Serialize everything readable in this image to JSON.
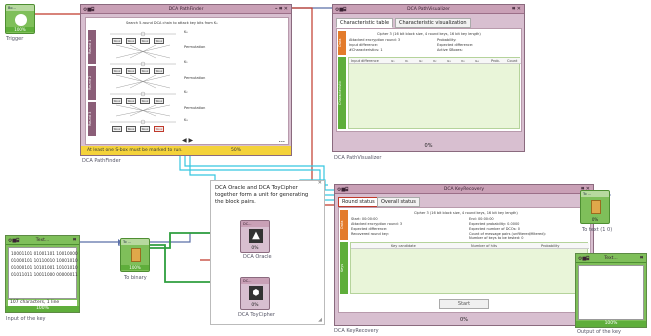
{
  "trigger": {
    "title": "Bo...",
    "percent": "100%",
    "label": "Trigger"
  },
  "pathfinder": {
    "title": "DCA PathFinder",
    "header_text": "Search 5-round DCA chain to attack key bits from K₀",
    "round_labels": [
      "Round 1",
      "Round 2",
      "Round 3"
    ],
    "side_labels": [
      "K₀",
      "K₁",
      "K₂",
      "K₃"
    ],
    "sbox_label": "Sbox",
    "perm_label": "Permutation",
    "warning": "At least one S-box must be marked to run.",
    "percent": "50%",
    "label": "DCA PathFinder",
    "dots": "•••"
  },
  "pathvisualizer": {
    "title": "DCA PathVisualizer",
    "tabs": [
      "Characteristic table",
      "Characteristic visualization"
    ],
    "caption": "Cipher 3 (16 bit block size, 4 round keys, 16 bit key length)",
    "info_left": [
      "Attacked encryption round: 3",
      "Input difference:",
      "#Characteristics: 1"
    ],
    "info_right": [
      "Probability:",
      "Expected difference:",
      "Active SBoxes:"
    ],
    "side_labels": [
      "Data",
      "Characteristic"
    ],
    "columns": [
      "Input difference",
      "u₁",
      "v₁",
      "u₂",
      "v₂",
      "u₃",
      "v₃",
      "u₄",
      "Prob.",
      "Count"
    ],
    "percent": "0%",
    "label": "DCA PathVisualizer"
  },
  "keyrecovery": {
    "title": "DCA KeyRecovery",
    "tabs": [
      "Round status",
      "Overall status"
    ],
    "caption": "Cipher 3 (16 bit block size, 4 round keys, 16 bit key length)",
    "info_left": [
      "Start: 00:00:00",
      "Attacked encryption round: 3",
      "Expected difference:",
      "Recovered round key:"
    ],
    "info_right": [
      "End: 00:00:00",
      "Expected probability: 0.0000",
      "Expected number of DCOs: 0",
      "Count of message pairs (unfiltered/filtered):",
      "Number of keys to be tested: 0"
    ],
    "side_labels": [
      "Data",
      "Keys"
    ],
    "columns": [
      "Key candidate",
      "Number of hits",
      "Probability"
    ],
    "button": "Start",
    "percent": "0%",
    "label": "DCA KeyRecovery"
  },
  "note": "DCA Oracle and DCA ToyCipher together form a unit for generating the block pairs.",
  "oracle": {
    "title": "DC...",
    "percent": "0%",
    "label": "DCA Oracle"
  },
  "toycipher": {
    "title": "DC...",
    "percent": "0%",
    "label": "DCA ToyCipher"
  },
  "input_key": {
    "title": "Text...",
    "lines": [
      "10001101 01001101 10010000",
      "01000101 10110010 10001010",
      "01000101 10101001 10101010",
      "01011011 10011000 00000011"
    ],
    "status": "107 characters, 1 line",
    "percent": "100%",
    "label": "Input of the key"
  },
  "to_binary": {
    "title": "To ...",
    "percent": "100%",
    "label": "To binary"
  },
  "to_text": {
    "title": "To ...",
    "percent": "0%",
    "label": "To text (1 0)"
  },
  "output_key": {
    "title": "Text...",
    "percent": "100%",
    "label": "Output of the key"
  },
  "colors": {
    "wire_red": "#c0392b",
    "wire_cyan": "#36c6e0",
    "wire_green": "#2e9e3e",
    "wire_blue": "#5b6fa8",
    "pink": "#d8bfd0",
    "green": "#7fbf5a"
  }
}
